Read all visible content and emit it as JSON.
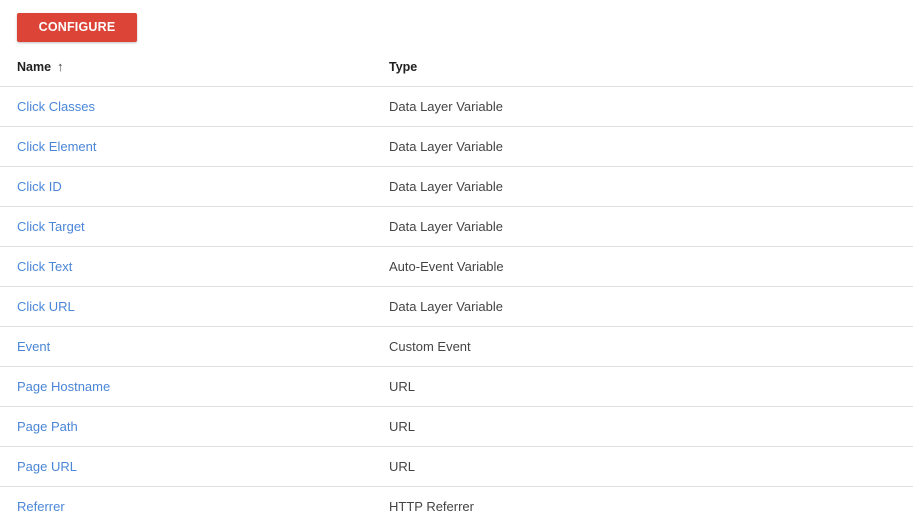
{
  "toolbar": {
    "configure_label": "CONFIGURE"
  },
  "table": {
    "columns": [
      {
        "label": "Name",
        "sort": "ascending",
        "sort_icon": "↑"
      },
      {
        "label": "Type"
      }
    ],
    "rows": [
      {
        "name": "Click Classes",
        "type": "Data Layer Variable"
      },
      {
        "name": "Click Element",
        "type": "Data Layer Variable"
      },
      {
        "name": "Click ID",
        "type": "Data Layer Variable"
      },
      {
        "name": "Click Target",
        "type": "Data Layer Variable"
      },
      {
        "name": "Click Text",
        "type": "Auto-Event Variable"
      },
      {
        "name": "Click URL",
        "type": "Data Layer Variable"
      },
      {
        "name": "Event",
        "type": "Custom Event"
      },
      {
        "name": "Page Hostname",
        "type": "URL"
      },
      {
        "name": "Page Path",
        "type": "URL"
      },
      {
        "name": "Page URL",
        "type": "URL"
      },
      {
        "name": "Referrer",
        "type": "HTTP Referrer"
      }
    ]
  },
  "colors": {
    "accent_button": "#db4437",
    "link": "#4a86d8",
    "text": "#444444",
    "divider": "#e0e0e0"
  }
}
